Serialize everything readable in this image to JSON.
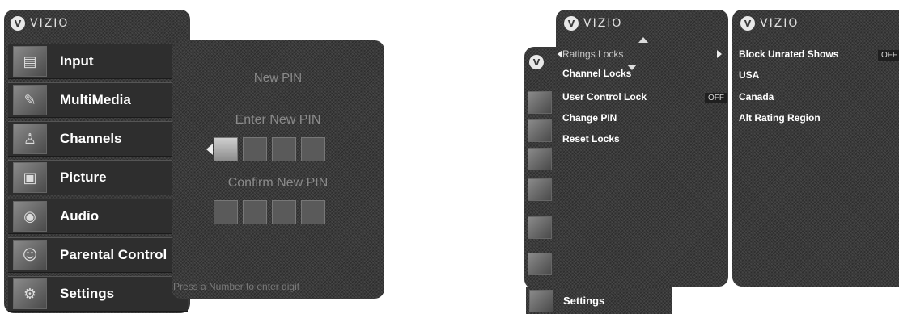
{
  "brand": {
    "logo_text": "VIZIO",
    "logo_mark": "V"
  },
  "main_menu": {
    "items": [
      {
        "label": "Input",
        "icon": "input-icon",
        "glyph": "▤"
      },
      {
        "label": "MultiMedia",
        "icon": "multimedia-icon",
        "glyph": "✎"
      },
      {
        "label": "Channels",
        "icon": "channels-icon",
        "glyph": "♙"
      },
      {
        "label": "Picture",
        "icon": "picture-icon",
        "glyph": "▣"
      },
      {
        "label": "Audio",
        "icon": "audio-icon",
        "glyph": "◉"
      },
      {
        "label": "Parental Control",
        "icon": "parental-control-icon",
        "glyph": "☺"
      },
      {
        "label": "Settings",
        "icon": "settings-icon",
        "glyph": "⚙"
      }
    ]
  },
  "pin_dialog": {
    "title": "New PIN",
    "enter_label": "Enter New PIN",
    "confirm_label": "Confirm New PIN",
    "hint": "Press a Number to enter digit"
  },
  "locks_menu": {
    "items": [
      {
        "label": "Ratings Locks",
        "value": ""
      },
      {
        "label": "Channel Locks",
        "value": ""
      },
      {
        "label": "User Control Lock",
        "value": "OFF"
      },
      {
        "label": "Change PIN",
        "value": ""
      },
      {
        "label": "Reset Locks",
        "value": ""
      }
    ]
  },
  "ratings_menu": {
    "items": [
      {
        "label": "Block Unrated Shows",
        "value": "OFF"
      },
      {
        "label": "USA",
        "value": ""
      },
      {
        "label": "Canada",
        "value": ""
      },
      {
        "label": "Alt Rating Region",
        "value": ""
      }
    ]
  },
  "settings_bar": {
    "label": "Settings"
  },
  "colors": {
    "panel": "#3a3a3a",
    "text": "#ffffff",
    "dim_text": "#8a8a8a"
  }
}
